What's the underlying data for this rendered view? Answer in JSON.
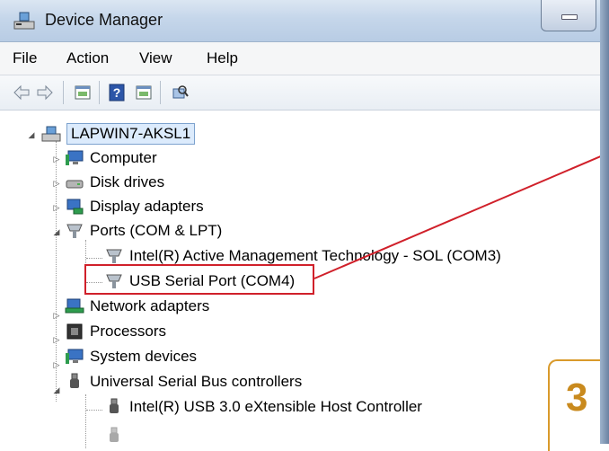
{
  "window": {
    "title": "Device Manager"
  },
  "menu": {
    "items": [
      "File",
      "Action",
      "View",
      "Help"
    ]
  },
  "toolbar": {
    "icons": [
      "back-arrow-icon",
      "forward-arrow-icon",
      "properties-icon",
      "help-icon",
      "show-hide-console-icon",
      "scan-hardware-icon"
    ]
  },
  "tree": {
    "root": "LAPWIN7-AKSL1",
    "items": [
      {
        "label": "Computer",
        "icon": "computer-icon"
      },
      {
        "label": "Disk drives",
        "icon": "disk-drive-icon"
      },
      {
        "label": "Display adapters",
        "icon": "display-adapter-icon"
      },
      {
        "label": "Ports (COM & LPT)",
        "icon": "port-icon"
      },
      {
        "label": "Intel(R) Active Management Technology - SOL (COM3)",
        "icon": "port-icon"
      },
      {
        "label": "USB Serial Port (COM4)",
        "icon": "port-icon"
      },
      {
        "label": "Network adapters",
        "icon": "network-adapter-icon"
      },
      {
        "label": "Processors",
        "icon": "processor-icon"
      },
      {
        "label": "System devices",
        "icon": "system-devices-icon"
      },
      {
        "label": "Universal Serial Bus controllers",
        "icon": "usb-icon"
      },
      {
        "label": "Intel(R) USB 3.0 eXtensible Host Controller",
        "icon": "usb-icon"
      }
    ]
  },
  "annotation": {
    "step": "3",
    "highlight_color": "#d0202a",
    "step_color": "#c98a1e"
  }
}
